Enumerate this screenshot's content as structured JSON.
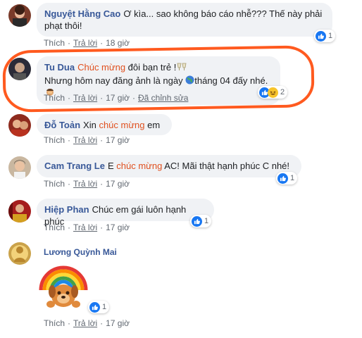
{
  "comments": [
    {
      "name": "Nguyệt Hằng Cao",
      "pre": "Ơ kìa... sao không báo cáo nhễ??? Thế này phải",
      "line2": "phạt thôi!",
      "like": "Thích",
      "reply": "Trả lời",
      "time": "18 giờ",
      "count": "1"
    },
    {
      "name": "Tu Dua",
      "hl": "Chúc mừng",
      "post": "đôi bạn trẻ !",
      "line2a": "Nhưng hôm nay đăng ảnh là ngày",
      "line2b": "tháng 04 đấy nhé.",
      "like": "Thích",
      "reply": "Trả lời",
      "time": "17 giờ",
      "edited": "Đã chỉnh sửa",
      "count": "2"
    },
    {
      "name": "Đỗ Toản",
      "pre": "Xin",
      "hl": "chúc mừng",
      "post": "em",
      "like": "Thích",
      "reply": "Trả lời",
      "time": "17 giờ"
    },
    {
      "name": "Cam Trang Le",
      "pre": "E",
      "hl": "chúc mừng",
      "post": "AC! Mãi thật hạnh phúc C nhé!",
      "like": "Thích",
      "reply": "Trả lời",
      "time": "17 giờ",
      "count": "1"
    },
    {
      "name": "Hiệp Phan",
      "post": "Chúc em gái luôn hạnh phúc",
      "like": "Thích",
      "reply": "Trả lời",
      "time": "17 giờ",
      "count": "1"
    },
    {
      "name": "Lương Quỳnh Mai",
      "like": "Thích",
      "reply": "Trả lời",
      "time": "17 giờ",
      "count": "1"
    }
  ],
  "colors": {
    "name": "#385898",
    "highlight": "#e0501f",
    "oval": "#ff5a1f",
    "like": "#1877f2"
  },
  "icons": [
    "like-icon",
    "haha-icon",
    "globe-icon",
    "cheers-icon",
    "facepalm-icon",
    "rainbow-sticker"
  ]
}
